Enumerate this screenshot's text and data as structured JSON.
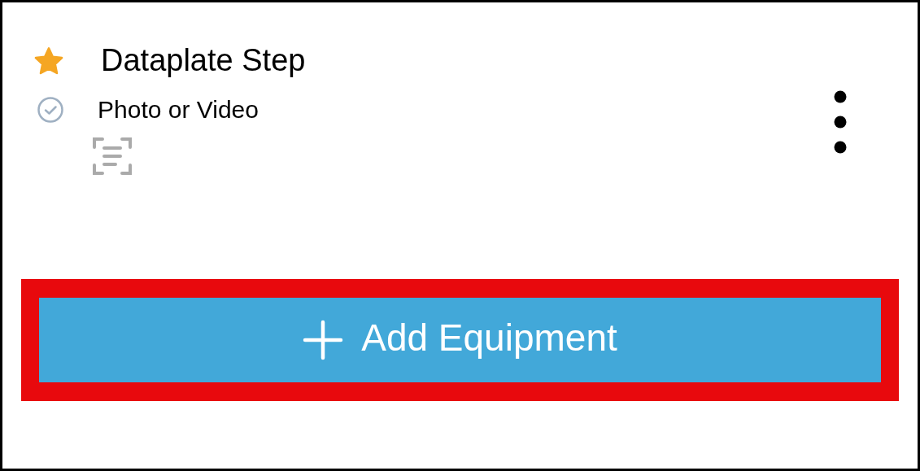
{
  "step": {
    "title": "Dataplate Step",
    "starred": true,
    "field": {
      "label": "Photo or Video"
    }
  },
  "add_button": {
    "label": "Add Equipment",
    "highlighted": true
  }
}
